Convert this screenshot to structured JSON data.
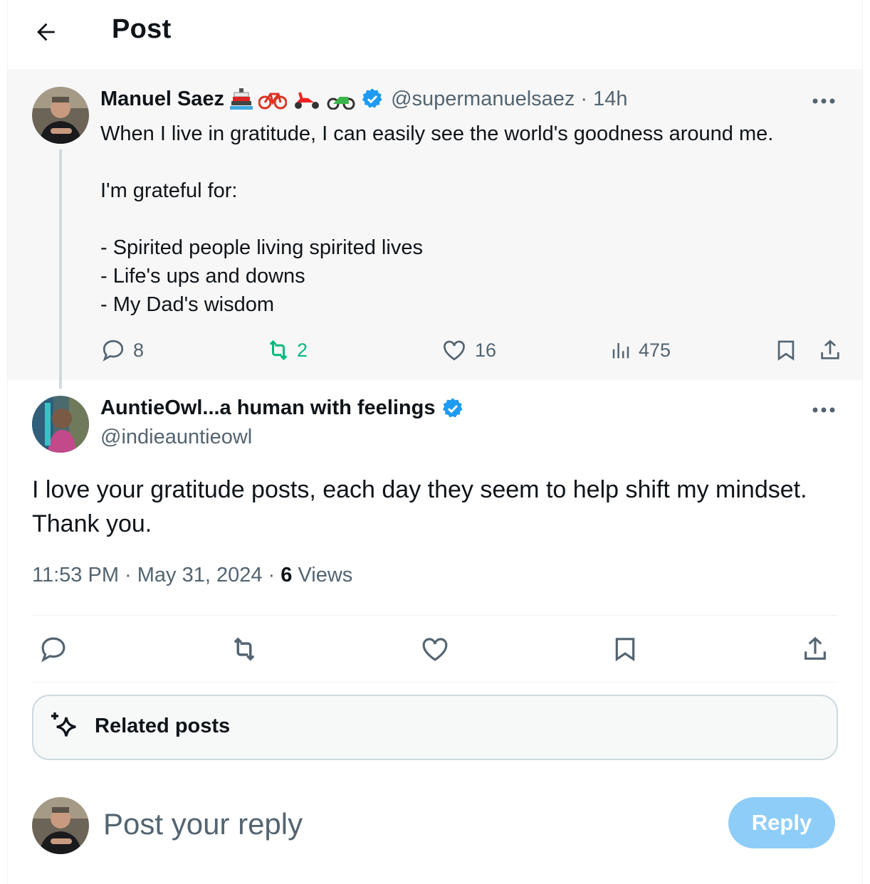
{
  "header": {
    "title": "Post",
    "back_icon": "arrow-left-icon"
  },
  "quoted_post": {
    "author_name": "Manuel Saez",
    "name_emojis": [
      "ship-icon",
      "bicycle-icon",
      "scooter-icon",
      "motorcycle-icon"
    ],
    "handle": "@supermanuelsaez",
    "separator": "·",
    "time": "14h",
    "lines": [
      "When I live in gratitude, I can easily see the world's goodness around me.",
      "",
      "I'm grateful for:",
      "",
      "- Spirited people living spirited lives",
      "- Life's ups and downs",
      "- My Dad's wisdom"
    ],
    "stats": {
      "replies": "8",
      "reposts": "2",
      "likes": "16",
      "views": "475"
    }
  },
  "reply_post": {
    "author_name": "AuntieOwl...a human with feelings",
    "handle": "@indieauntieowl",
    "text": "I love your gratitude posts, each day they seem to help shift my mindset. Thank you.",
    "time": "11:53 PM",
    "sep1": " · ",
    "date": "May 31, 2024",
    "sep2": " · ",
    "views_count": "6",
    "views_label": " Views"
  },
  "related": {
    "label": "Related posts",
    "icon": "sparkle-icon"
  },
  "composer": {
    "placeholder": "Post your reply",
    "reply_label": "Reply"
  },
  "colors": {
    "accent": "#1d9bf0",
    "repost_green": "#00ba7c",
    "muted": "#536471",
    "reply_button_disabled": "#8ecdf8",
    "quoted_bg": "#f7f7f7"
  }
}
